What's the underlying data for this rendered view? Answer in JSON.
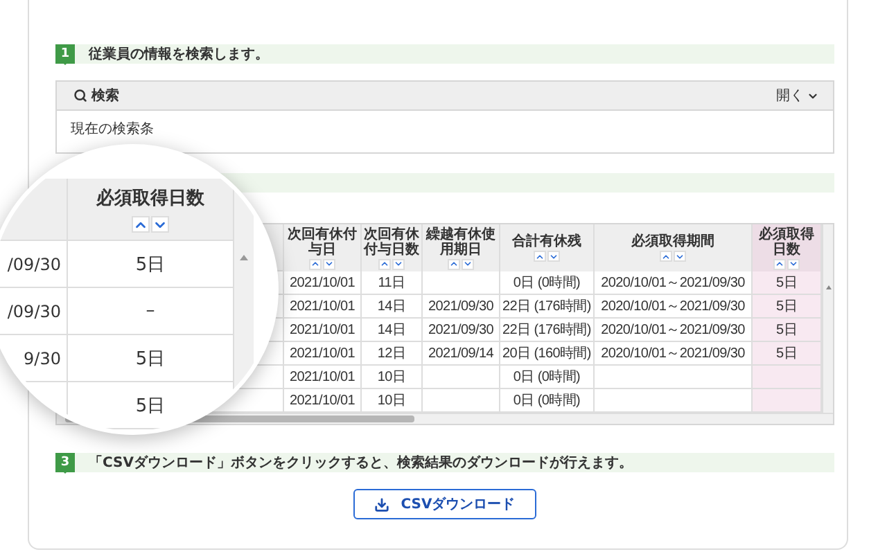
{
  "steps": [
    {
      "kind": "full",
      "number": "1",
      "text": "従業員の情報を検索します。"
    },
    {
      "kind": "bar"
    },
    {
      "kind": "full",
      "number": "3",
      "text": "「CSVダウンロード」ボタンをクリックすると、検索結果のダウンロードが行えます。"
    }
  ],
  "search_panel": {
    "title": "検索",
    "toggle": "開く",
    "expanded": false,
    "summary": "現在の検索条"
  },
  "table": {
    "columns": [
      {
        "label": "次回有休付与日",
        "highlighted": false
      },
      {
        "label": "次回有休付与日数",
        "highlighted": false
      },
      {
        "label": "繰越有休使用期日",
        "highlighted": false
      },
      {
        "label": "合計有休残",
        "highlighted": false
      },
      {
        "label": "必須取得期間",
        "highlighted": false
      },
      {
        "label": "必須取得日数",
        "highlighted": true
      }
    ],
    "rows": [
      [
        "2021/10/01",
        "11日",
        null,
        "0日 (0時間)",
        "2020/10/01～2021/09/30",
        "5日"
      ],
      [
        "2021/10/01",
        "14日",
        "2021/09/30",
        "22日 (176時間)",
        "2020/10/01～2021/09/30",
        "5日"
      ],
      [
        "2021/10/01",
        "14日",
        "2021/09/30",
        "22日 (176時間)",
        "2020/10/01～2021/09/30",
        "5日"
      ],
      [
        "2021/10/01",
        "12日",
        "2021/09/14",
        "20日 (160時間)",
        "2020/10/01～2021/09/30",
        "5日"
      ],
      [
        "2021/10/01",
        "10日",
        null,
        "0日 (0時間)",
        null,
        null
      ],
      [
        "2021/10/01",
        "10日",
        null,
        "0日 (0時間)",
        null,
        null
      ]
    ]
  },
  "magnifier": {
    "header": "必須取得日数",
    "rows": [
      {
        "side": "/09/30",
        "value": "5日"
      },
      {
        "side": "/09/30",
        "value": "–"
      },
      {
        "side": "9/30",
        "value": "5日"
      },
      {
        "value": "5日"
      }
    ]
  },
  "download_button": {
    "label": "CSVダウンロード"
  }
}
